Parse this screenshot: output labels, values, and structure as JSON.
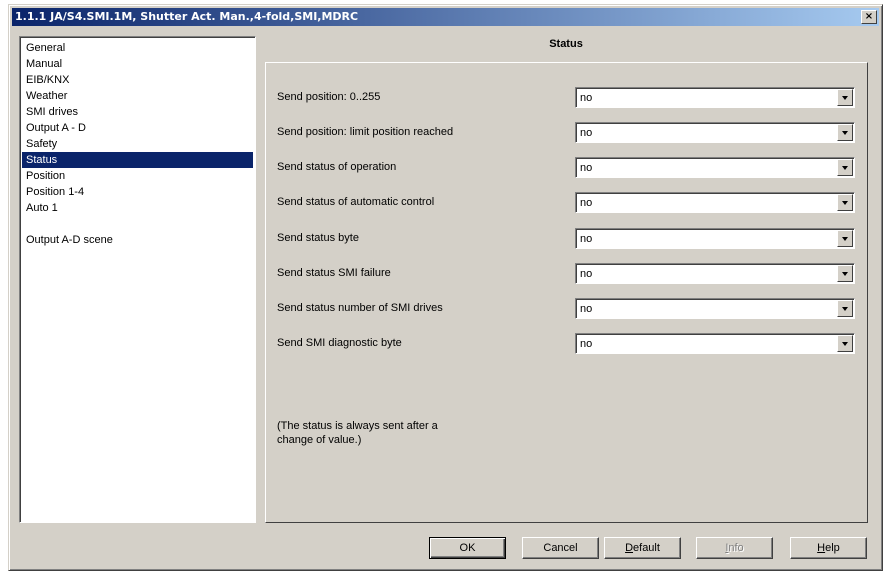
{
  "window": {
    "title": "1.1.1 JA/S4.SMI.1M, Shutter Act. Man.,4-fold,SMI,MDRC",
    "close_label": "×"
  },
  "sidebar": {
    "items": [
      {
        "label": "General"
      },
      {
        "label": "Manual"
      },
      {
        "label": "EIB/KNX"
      },
      {
        "label": "Weather"
      },
      {
        "label": "SMI drives"
      },
      {
        "label": "Output A - D"
      },
      {
        "label": "Safety"
      },
      {
        "label": "Status",
        "selected": true
      },
      {
        "label": "Position"
      },
      {
        "label": "Position 1-4"
      },
      {
        "label": "Auto 1"
      },
      {
        "label": ""
      },
      {
        "label": "Output A-D scene"
      }
    ]
  },
  "panel": {
    "title": "Status",
    "rows": [
      {
        "label": "Send position: 0..255",
        "value": "no"
      },
      {
        "label": "Send position: limit position reached",
        "value": "no"
      },
      {
        "label": "Send status of operation",
        "value": "no"
      },
      {
        "label": "Send status of automatic control",
        "value": "no"
      },
      {
        "label": "Send status byte",
        "value": "no"
      },
      {
        "label": "Send status SMI failure",
        "value": "no"
      },
      {
        "label": "Send status number of SMI drives",
        "value": "no"
      },
      {
        "label": "Send SMI diagnostic byte",
        "value": "no"
      }
    ],
    "note_line1": "(The status is always sent after a",
    "note_line2": "change of value.)"
  },
  "buttons": {
    "ok": "OK",
    "cancel": "Cancel",
    "default_pre": "",
    "default_ul": "D",
    "default_post": "efault",
    "info_pre": "",
    "info_ul": "I",
    "info_post": "nfo",
    "help_pre": "",
    "help_ul": "H",
    "help_post": "elp"
  },
  "colors": {
    "title_bar": "#0a246a",
    "selection": "#0a246a",
    "face": "#d4d0c8"
  }
}
